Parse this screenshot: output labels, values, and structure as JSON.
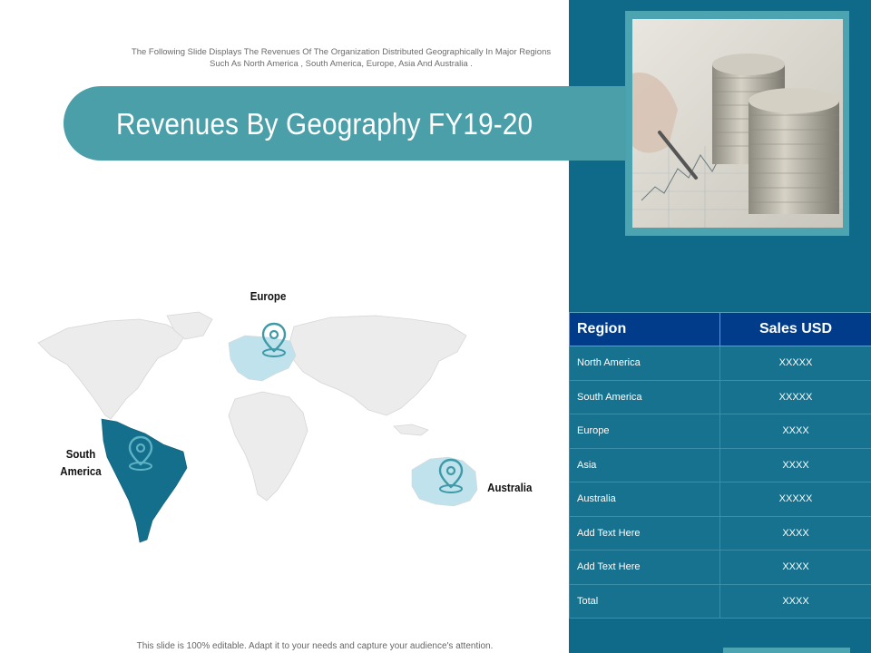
{
  "intro_text": "The Following Slide Displays The Revenues Of The Organization Distributed Geographically In Major Regions Such As North America , South America, Europe, Asia And Australia .",
  "title": "Revenues By Geography FY19-20",
  "map": {
    "labels": {
      "europe": "Europe",
      "south_america_line1": "South",
      "south_america_line2": "America",
      "australia": "Australia"
    },
    "icons": [
      "location-pin-icon",
      "location-pin-icon",
      "location-pin-icon"
    ],
    "colors": {
      "land": "#ececec",
      "highlight_dark": "#136f8b",
      "highlight_light": "#bfe2ec",
      "pin": "#4ca4b0"
    }
  },
  "table": {
    "headers": [
      "Region",
      "Sales USD"
    ],
    "rows": [
      [
        "North America",
        "XXXXX"
      ],
      [
        "South America",
        "XXXXX"
      ],
      [
        "Europe",
        "XXXX"
      ],
      [
        "Asia",
        "XXXX"
      ],
      [
        "Australia",
        "XXXXX"
      ],
      [
        "Add Text Here",
        "XXXX"
      ],
      [
        "Add Text Here",
        "XXXX"
      ],
      [
        "Total",
        "XXXX"
      ]
    ]
  },
  "footer": "This slide is 100% editable. Adapt it to your needs and capture your audience's attention.",
  "colors": {
    "panel": "#0f6a89",
    "accent": "#4a9fa9",
    "header": "#003c8a"
  }
}
